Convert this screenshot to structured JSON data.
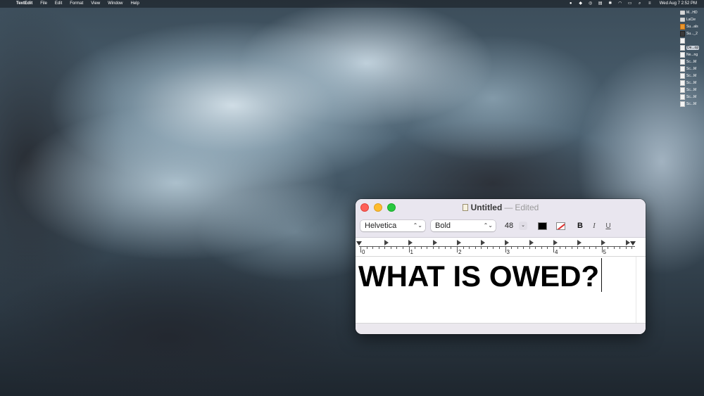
{
  "menubar": {
    "apple_glyph": "",
    "app_name": "TextEdit",
    "menus": [
      "File",
      "Edit",
      "Format",
      "View",
      "Window",
      "Help"
    ],
    "clock": "Wed Aug 7  2:52 PM"
  },
  "desktop_icons": [
    {
      "label": "M...HD",
      "kind": "drive"
    },
    {
      "label": "LaCie",
      "kind": "drive"
    },
    {
      "label": "Su...als",
      "kind": "orange"
    },
    {
      "label": "Su..._2",
      "kind": "dark"
    },
    {
      "label": "",
      "kind": "doc"
    },
    {
      "label": "De...op",
      "kind": "doc",
      "selected": true
    },
    {
      "label": "Ne...ng",
      "kind": "doc"
    },
    {
      "label": "Sc...M",
      "kind": "doc"
    },
    {
      "label": "Sc...M",
      "kind": "doc"
    },
    {
      "label": "Sc...M",
      "kind": "doc"
    },
    {
      "label": "Sc...M",
      "kind": "doc"
    },
    {
      "label": "Sc...M",
      "kind": "doc"
    },
    {
      "label": "Sc...M",
      "kind": "doc"
    },
    {
      "label": "Sc...M",
      "kind": "doc"
    }
  ],
  "window": {
    "title": "Untitled",
    "separator": "—",
    "status": "Edited"
  },
  "format_bar": {
    "font_family": "Helvetica",
    "font_style": "Bold",
    "font_size": "48",
    "text_color": "#000000",
    "bold_label": "B",
    "italic_label": "I",
    "underline_label": "U"
  },
  "ruler": {
    "numbers": [
      "0",
      "1",
      "2",
      "3",
      "4",
      "5"
    ]
  },
  "document": {
    "text": "WHAT IS OWED?"
  },
  "colors": {
    "close": "#fe5f57",
    "minimize": "#febc2e",
    "zoom": "#28c840",
    "titlebar": "#e9e6ef"
  }
}
